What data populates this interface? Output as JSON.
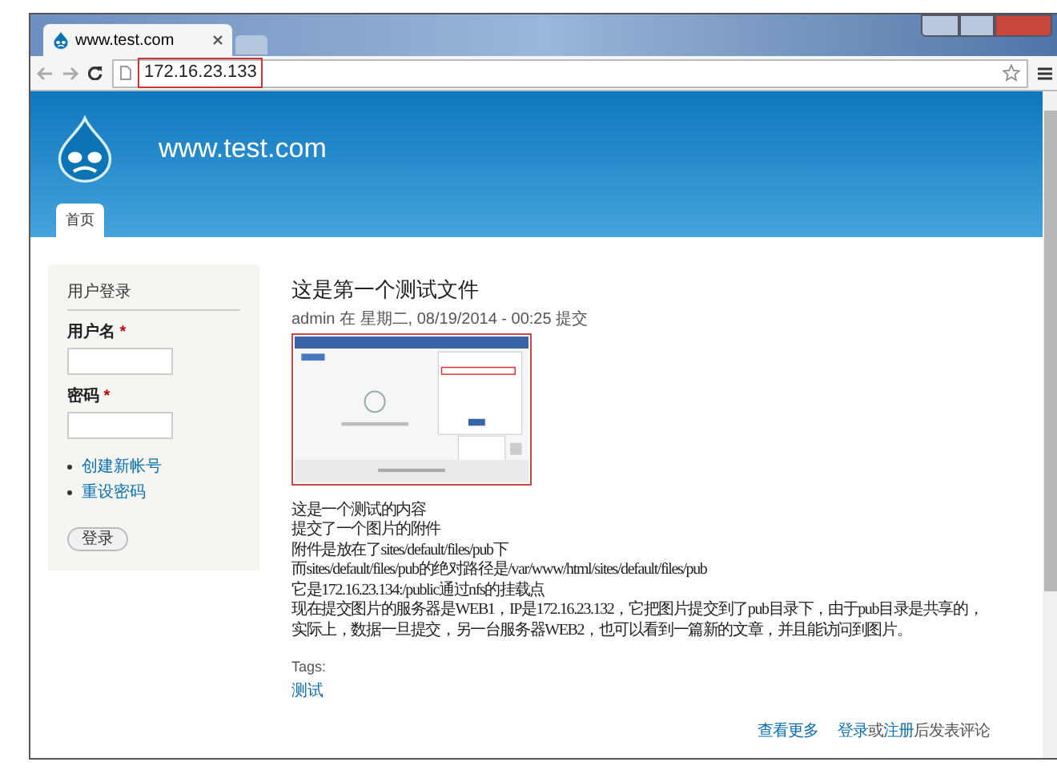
{
  "browser": {
    "tabs": [
      {
        "title": "www.test.com",
        "selected": true
      },
      {
        "selected": false
      }
    ],
    "address": "172.16.23.133"
  },
  "site": {
    "name": "www.test.com",
    "nav": [
      {
        "label": "首页",
        "selected": true
      }
    ]
  },
  "login_block": {
    "title": "用户登录",
    "fields": [
      {
        "label": "用户名",
        "required_mark": "*"
      },
      {
        "label": "密码",
        "required_mark": "*"
      }
    ],
    "links": [
      "创建新帐号",
      "重设密码"
    ],
    "submit": "登录"
  },
  "article": {
    "title": "这是第一个测试文件",
    "meta": "admin 在 星期二, 08/19/2014 - 00:25 提交",
    "image": {
      "kind": "picture"
    },
    "body": [
      "这是一个测试的内容",
      "提交了一个图片的附件",
      "附件是放在了sites/default/files/pub下",
      "而sites/default/files/pub的绝对路径是/var/www/html/sites/default/files/pub",
      "它是172.16.23.134:/public通过nfs的挂载点",
      "现在提交图片的服务器是WEB1，IP是172.16.23.132，它把图片提交到了pub目录下，由于pub目录是共享的，",
      "实际上，数据一旦提交，另一台服务器WEB2，也可以看到一篇新的文章，并且能访问到图片。"
    ],
    "tags_label": "Tags:",
    "tags": [
      "测试"
    ],
    "footer_links": [
      {
        "kind": "link",
        "text": "查看更多"
      },
      {
        "kind": "link",
        "text": "登录"
      },
      {
        "kind": "text",
        "text": "或"
      },
      {
        "kind": "link",
        "text": "注册"
      },
      {
        "kind": "text",
        "text": "后发表评论"
      }
    ]
  }
}
